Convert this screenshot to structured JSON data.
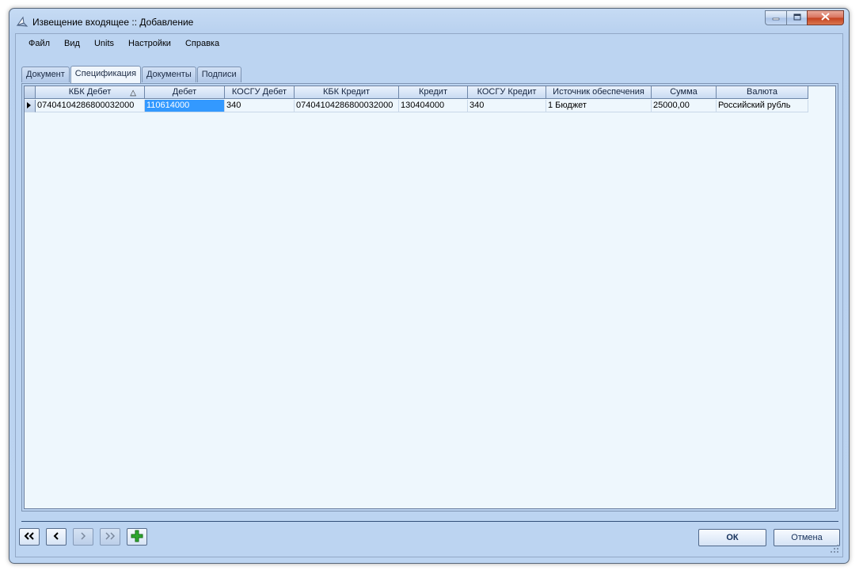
{
  "window": {
    "title": "Извещение входящее :: Добавление"
  },
  "menu": [
    {
      "label": "Файл"
    },
    {
      "label": "Вид"
    },
    {
      "label": "Units"
    },
    {
      "label": "Настройки"
    },
    {
      "label": "Справка"
    }
  ],
  "tabs": [
    {
      "label": "Документ",
      "active": false
    },
    {
      "label": "Спецификация",
      "active": true
    },
    {
      "label": "Документы",
      "active": false
    },
    {
      "label": "Подписи",
      "active": false
    }
  ],
  "grid": {
    "columns": [
      "КБК Дебет",
      "Дебет",
      "КОСГУ Дебет",
      "КБК Кредит",
      "Кредит",
      "КОСГУ Кредит",
      "Источник обеспечения",
      "Сумма",
      "Валюта"
    ],
    "sorted_column": "КБК Дебет",
    "sort_icon": "△",
    "rows": [
      [
        "07404104286800032000",
        "110614000",
        "340",
        "07404104286800032000",
        "130404000",
        "340",
        "1 Бюджет",
        "25000,00",
        "Российский рубль"
      ]
    ],
    "selected_cell": {
      "row": 0,
      "column": "Дебет"
    }
  },
  "footer": {
    "ok_label": "ОК",
    "cancel_label": "Отмена"
  },
  "colors": {
    "window_bg": "#bcd4f1",
    "grid_bg": "#eef7fd",
    "selection": "#3399ff",
    "add_icon": "#2ea82e"
  }
}
